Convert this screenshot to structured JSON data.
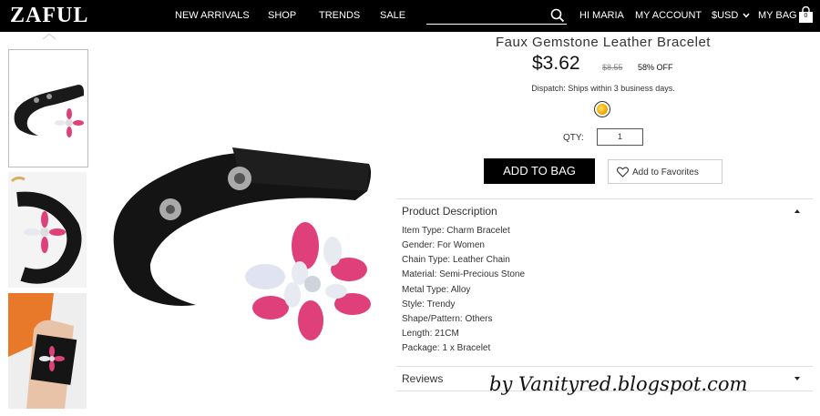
{
  "header": {
    "logo": "ZAFUL",
    "nav": [
      "NEW ARRIVALS",
      "SHOP",
      "TRENDS",
      "SALE"
    ],
    "search_placeholder": "",
    "greeting": "HI MARIA",
    "account": "MY ACCOUNT",
    "currency": "$USD",
    "bag": "MY BAG",
    "bag_count": "0"
  },
  "product": {
    "title": "Faux Gemstone Leather Bracelet",
    "price": "$3.62",
    "old_price": "$8.55",
    "discount": "58% OFF",
    "dispatch": "Dispatch: Ships within 3 business days.",
    "swatch_color": "#f2a900",
    "qty_label": "QTY:",
    "qty_value": "1",
    "add_to_bag": "ADD TO BAG",
    "add_to_favorites": "Add to Favorites"
  },
  "description": {
    "heading": "Product Description",
    "specs": [
      "Item Type: Charm Bracelet",
      "Gender: For Women",
      "Chain Type: Leather Chain",
      "Material: Semi-Precious Stone",
      "Metal Type: Alloy",
      "Style: Trendy",
      "Shape/Pattern: Others",
      "Length: 21CM",
      "Package: 1 x Bracelet"
    ]
  },
  "reviews": {
    "heading": "Reviews"
  },
  "watermark": "by Vanityred.blogspot.com",
  "icons": [
    "search-icon",
    "bag-icon",
    "chevron-up-icon",
    "heart-icon",
    "chevron-down-icon"
  ]
}
